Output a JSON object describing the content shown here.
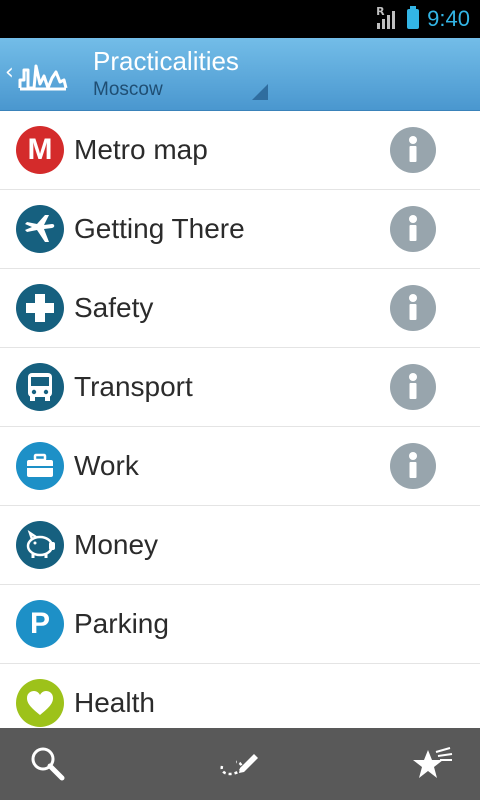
{
  "status_bar": {
    "time": "9:40",
    "signal_label": "R",
    "battery_color": "#33b5e5",
    "icons": [
      "signal-icon",
      "battery-icon"
    ]
  },
  "action_bar": {
    "title": "Practicalities",
    "subtitle": "Moscow",
    "icons": [
      "back-chevron-icon",
      "app-logo-icon",
      "spinner-triangle-icon"
    ],
    "background": "#5ea9dc"
  },
  "list": {
    "items": [
      {
        "label": "Metro map",
        "icon": "metro-m-icon",
        "icon_color": "#d42b2b",
        "has_info": true
      },
      {
        "label": "Getting There",
        "icon": "airplane-icon",
        "icon_color": "#16607f",
        "has_info": true
      },
      {
        "label": "Safety",
        "icon": "plus-icon",
        "icon_color": "#16607f",
        "has_info": true
      },
      {
        "label": "Transport",
        "icon": "bus-icon",
        "icon_color": "#16607f",
        "has_info": true
      },
      {
        "label": "Work",
        "icon": "briefcase-icon",
        "icon_color": "#1d90c7",
        "has_info": true
      },
      {
        "label": "Money",
        "icon": "piggy-bank-icon",
        "icon_color": "#16607f",
        "has_info": false
      },
      {
        "label": "Parking",
        "icon": "parking-icon",
        "icon_color": "#1d90c7",
        "has_info": false
      },
      {
        "label": "Health",
        "icon": "heart-icon",
        "icon_color": "#9dc21a",
        "has_info": false
      }
    ],
    "info_icon_color": "#98a5ad",
    "metro_letter": "M",
    "parking_letter": "P"
  },
  "bottom_bar": {
    "buttons": [
      {
        "name": "search-button",
        "icon": "search-icon"
      },
      {
        "name": "route-button",
        "icon": "route-pencil-icon"
      },
      {
        "name": "favorites-button",
        "icon": "star-icon"
      }
    ]
  }
}
